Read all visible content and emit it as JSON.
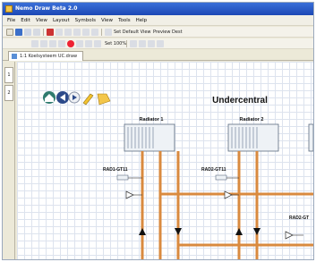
{
  "window": {
    "title": "Nemo Draw Beta 2.0"
  },
  "menu": [
    "File",
    "Edit",
    "View",
    "Layout",
    "Symbols",
    "View",
    "Tools",
    "Help"
  ],
  "toolbar": {
    "default_view_label": "Set Default View",
    "preview_label": "Preview Dest",
    "zoom_label": "Set 100%"
  },
  "tab": {
    "label": "1:1 Koelsysteem UC.draw"
  },
  "side_tabs": [
    "1",
    "2"
  ],
  "diagram": {
    "title": "Undercentral",
    "radiator1_label": "Radiator 1",
    "radiator2_label": "Radiator 2",
    "valve1_label": "RAD1-GT11",
    "valve2_label": "RAD2-GT11",
    "valve3_label": "RAD2-GT",
    "colors": {
      "pipe": "#d98a3f",
      "arrow": "#111111",
      "unit_fill": "#eef2f6"
    }
  }
}
